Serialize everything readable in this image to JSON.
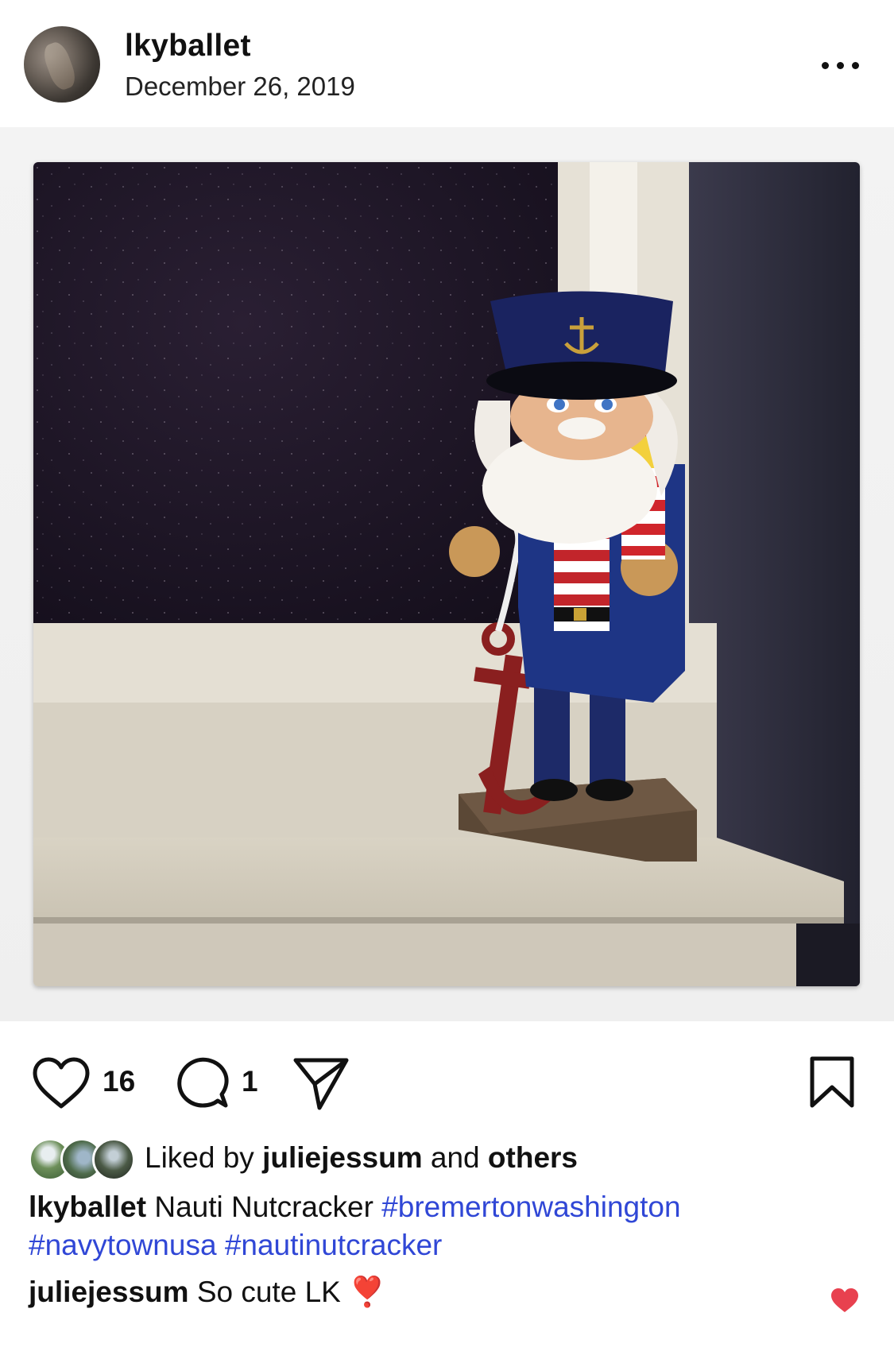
{
  "post": {
    "username": "lkyballet",
    "date": "December 26, 2019"
  },
  "actions": {
    "like_count": "16",
    "comment_count": "1"
  },
  "likes": {
    "prefix": "Liked by",
    "user": "juliejessum",
    "and": "and",
    "others": "others"
  },
  "caption": {
    "username": "lkyballet",
    "text": "Nauti Nutcracker",
    "hashtags": [
      "#bremertonwashington",
      "#navytownusa",
      "#nautinutcracker"
    ]
  },
  "comment": {
    "username": "juliejessum",
    "text": "So cute LK",
    "emoji": "❣️"
  },
  "colors": {
    "hashtag": "#3047d6",
    "liked_heart": "#e8414f"
  },
  "icons": [
    "heart-icon",
    "comment-icon",
    "share-icon",
    "bookmark-icon",
    "more-options-icon"
  ]
}
